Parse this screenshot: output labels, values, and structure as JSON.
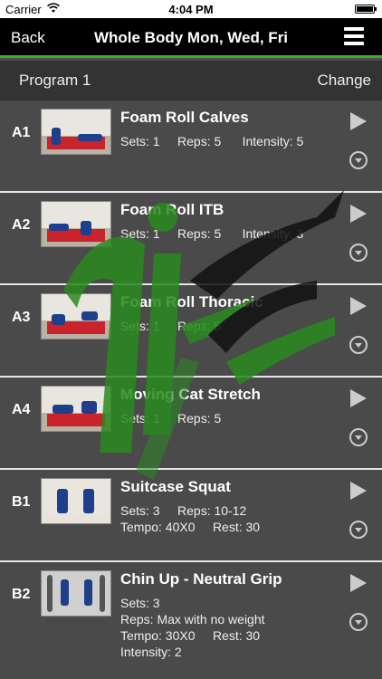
{
  "status": {
    "carrier": "Carrier",
    "time": "4:04 PM"
  },
  "nav": {
    "back_label": "Back",
    "title": "Whole Body Mon, Wed, Fri"
  },
  "program": {
    "name": "Program 1",
    "change_label": "Change"
  },
  "colors": {
    "accent_green": "#3fae2a",
    "row_bg": "#4a4a4a",
    "nav_bg": "#000000"
  },
  "exercises": [
    {
      "code": "A1",
      "name": "Foam Roll Calves",
      "lines": [
        "Sets: 1     Reps: 5      Intensity: 5"
      ]
    },
    {
      "code": "A2",
      "name": "Foam Roll ITB",
      "lines": [
        "Sets: 1     Reps: 5      Intensity: 3"
      ]
    },
    {
      "code": "A3",
      "name": "Foam Roll Thoracic",
      "lines": [
        "Sets: 1     Reps: 5"
      ]
    },
    {
      "code": "A4",
      "name": "Moving Cat Stretch",
      "lines": [
        "Sets: 1     Reps: 5"
      ]
    },
    {
      "code": "B1",
      "name": "Suitcase Squat",
      "lines": [
        "Sets: 3     Reps: 10-12",
        "Tempo: 40X0     Rest: 30"
      ]
    },
    {
      "code": "B2",
      "name": "Chin Up - Neutral Grip",
      "lines": [
        "Sets: 3",
        "Reps: Max with no weight",
        "Tempo: 30X0     Rest: 30",
        "Intensity: 2"
      ]
    }
  ]
}
